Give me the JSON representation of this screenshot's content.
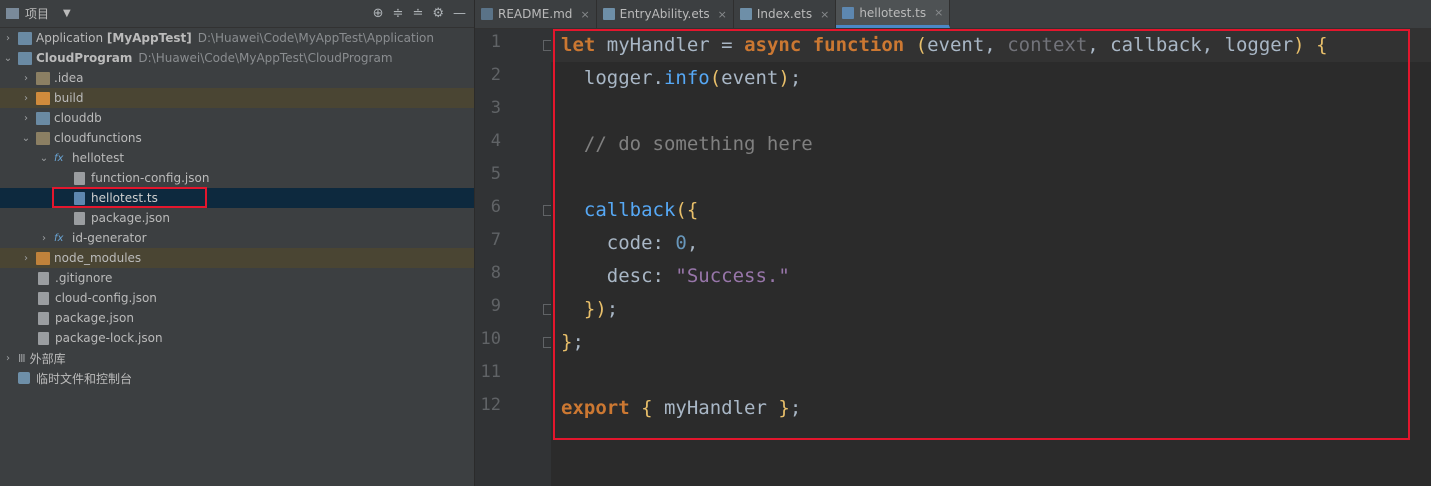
{
  "project_panel": {
    "title": "项目",
    "tree": [
      {
        "label": "Application",
        "extra": "[MyAppTest]",
        "path": "D:\\Huawei\\Code\\MyAppTest\\Application"
      },
      {
        "label": "CloudProgram",
        "path": "D:\\Huawei\\Code\\MyAppTest\\CloudProgram"
      },
      {
        "label": ".idea"
      },
      {
        "label": "build"
      },
      {
        "label": "clouddb"
      },
      {
        "label": "cloudfunctions"
      },
      {
        "label": "hellotest"
      },
      {
        "label": "function-config.json"
      },
      {
        "label": "hellotest.ts"
      },
      {
        "label": "package.json"
      },
      {
        "label": "id-generator"
      },
      {
        "label": "node_modules"
      },
      {
        "label": ".gitignore"
      },
      {
        "label": "cloud-config.json"
      },
      {
        "label": "package.json"
      },
      {
        "label": "package-lock.json"
      },
      {
        "label": "外部库"
      },
      {
        "label": "临时文件和控制台"
      }
    ],
    "fx_label": "fx"
  },
  "tabs": [
    {
      "label": "README.md"
    },
    {
      "label": "EntryAbility.ets"
    },
    {
      "label": "Index.ets"
    },
    {
      "label": "hellotest.ts"
    }
  ],
  "tab_close": "×",
  "line_numbers": [
    "1",
    "2",
    "3",
    "4",
    "5",
    "6",
    "7",
    "8",
    "9",
    "10",
    "11",
    "12"
  ],
  "code": {
    "l1": {
      "let": "let",
      "name": " myHandler ",
      "eq": "= ",
      "async": "async",
      "function": " function ",
      "open": "(",
      "event": "event, ",
      "context": "context",
      "rest": ", callback, logger",
      "close": ")",
      "brace": " {"
    },
    "l2": {
      "obj": "  logger.",
      "method": "info",
      "open": "(",
      "arg": "event",
      "close": ")",
      "end": ";"
    },
    "l4": {
      "comment": "  // do something here"
    },
    "l6": {
      "call": "  callback",
      "open": "({"
    },
    "l7": {
      "key": "    code: ",
      "val": "0",
      "end": ","
    },
    "l8": {
      "key": "    desc: ",
      "val": "\"Success.\""
    },
    "l9": {
      "close": "  })",
      "end": ";"
    },
    "l10": {
      "close": "}",
      "end": ";"
    },
    "l12": {
      "export": "export",
      "open": " { ",
      "name": "myHandler",
      "close": " }",
      "end": ";"
    }
  },
  "colors": {
    "highlight_box": "#e3162d",
    "selected_row": "#0d293e"
  }
}
